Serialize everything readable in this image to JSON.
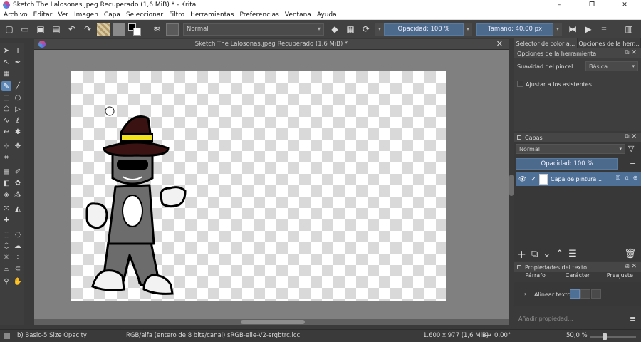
{
  "window": {
    "title": "Sketch The Lalosonas.jpeg Recuperado (1,6 MiB) * - Krita",
    "controls": [
      "–",
      "❐",
      "✕"
    ]
  },
  "menu": [
    "Archivo",
    "Editar",
    "Ver",
    "Imagen",
    "Capa",
    "Seleccionar",
    "Filtro",
    "Herramientas",
    "Preferencias",
    "Ventana",
    "Ayuda"
  ],
  "toolbar": {
    "blend_mode": "Normal",
    "opacity_label": "Opacidad: 100 %",
    "size_label": "Tamaño: 40,00 px",
    "opacity_fill": 1.0
  },
  "document": {
    "tab_title": "Sketch The Lalosonas.jpeg Recuperado (1,6 MiB) *"
  },
  "dockers": {
    "top_tabs": [
      "Selector de color a...",
      "Opciones de la herr..."
    ],
    "tool_options": {
      "header": "Opciones de la herramienta",
      "smoothing_label": "Suavidad del pincel:",
      "smoothing_value": "Básica",
      "assistants_label": "Ajustar a los asistentes"
    },
    "layers": {
      "header": "Capas",
      "blend_mode": "Normal",
      "opacity_label": "Opacidad: 100 %",
      "layer_name": "Capa de pintura 1"
    },
    "text_properties": {
      "header": "Propiedades del texto",
      "tabs": [
        "Párrafo",
        "Carácter",
        "Preajuste"
      ],
      "align_label": "Alinear texto",
      "add_property_placeholder": "Añadir propiedad..."
    }
  },
  "status": {
    "brush": "b) Basic-5 Size Opacity",
    "color_model": "RGB/alfa (entero de 8 bits/canal)  sRGB-elle-V2-srgbtrc.icc",
    "image_size": "1.600 x 977 (1,6 MiB)",
    "rotation": "0,00°",
    "zoom": "50,0 %",
    "zoom_fraction": 0.3
  },
  "colors": {
    "accent": "#5b86b5",
    "dark_bg": "#3e3e3e",
    "canvas_bg": "#808080",
    "hat_brown": "#3a1212",
    "hat_band": "#f2e21d",
    "figure_gray": "#6c6c6c"
  }
}
